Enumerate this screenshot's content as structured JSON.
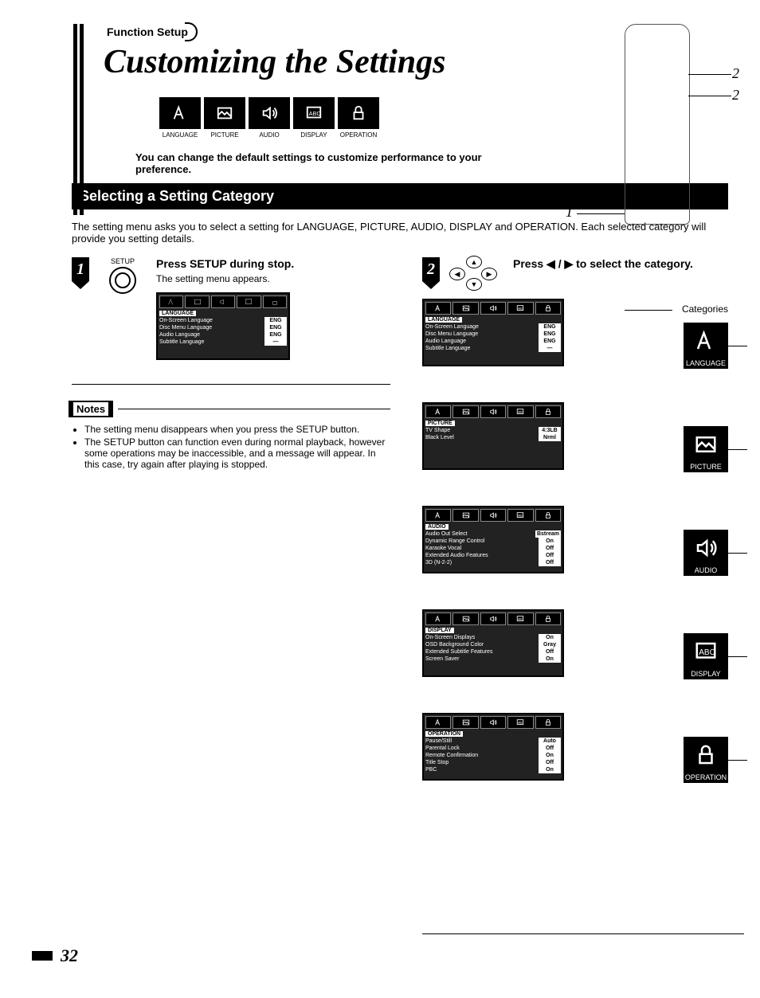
{
  "header": {
    "tag": "Function Setup",
    "title": "Customizing the Settings",
    "intro": "You can change the default settings to customize performance to your preference."
  },
  "icon_strip": [
    "LANGUAGE",
    "PICTURE",
    "AUDIO",
    "DISPLAY",
    "OPERATION"
  ],
  "remote_callouts": {
    "r1": "2",
    "r2": "2",
    "r3": "1"
  },
  "section": {
    "bar": "Selecting a Setting Category",
    "intro": "The setting menu asks you to select a setting for LANGUAGE, PICTURE, AUDIO, DISPLAY and OPERATION.  Each selected category will provide you setting details."
  },
  "step1": {
    "num": "1",
    "btn": "SETUP",
    "title": "Press SETUP during stop.",
    "sub": "The setting menu appears.",
    "osd": {
      "cat": "LANGUAGE",
      "rows": [
        {
          "k": "On-Screen Language",
          "v": "ENG"
        },
        {
          "k": "Disc Menu Language",
          "v": "ENG"
        },
        {
          "k": "Audio Language",
          "v": "ENG"
        },
        {
          "k": "Subtitle Language",
          "v": "—"
        }
      ]
    }
  },
  "notes": {
    "label": "Notes",
    "items": [
      "The setting menu disappears when you press the SETUP button.",
      "The SETUP button can function even during normal playback, however some operations may be inaccessible, and a message will appear. In this case, try again after playing is stopped."
    ]
  },
  "step2": {
    "num": "2",
    "title": "Press ◀ / ▶ to select the category.",
    "cat_label": "Categories"
  },
  "categories": [
    {
      "name": "LANGUAGE",
      "rows": [
        {
          "k": "On-Screen Language",
          "v": "ENG"
        },
        {
          "k": "Disc Menu Language",
          "v": "ENG"
        },
        {
          "k": "Audio Language",
          "v": "ENG"
        },
        {
          "k": "Subtitle Language",
          "v": "—"
        }
      ]
    },
    {
      "name": "PICTURE",
      "rows": [
        {
          "k": "TV Shape",
          "v": "4:3LB"
        },
        {
          "k": "Black Level",
          "v": "Nrml"
        }
      ]
    },
    {
      "name": "AUDIO",
      "rows": [
        {
          "k": "Audio Out Select",
          "v": "Bstream"
        },
        {
          "k": "Dynamic Range Control",
          "v": "On"
        },
        {
          "k": "Karaoke Vocal",
          "v": "Off"
        },
        {
          "k": "Extended Audio Features",
          "v": "Off"
        },
        {
          "k": "3D (N-2-2)",
          "v": "Off"
        }
      ]
    },
    {
      "name": "DISPLAY",
      "rows": [
        {
          "k": "On-Screen Displays",
          "v": "On"
        },
        {
          "k": "OSD Background Color",
          "v": "Gray"
        },
        {
          "k": "Extended Subtitle Features",
          "v": "Off"
        },
        {
          "k": "Screen Saver",
          "v": "On"
        }
      ]
    },
    {
      "name": "OPERATION",
      "rows": [
        {
          "k": "Pause/Still",
          "v": "Auto"
        },
        {
          "k": "Parental Lock",
          "v": "Off"
        },
        {
          "k": "Remote Confirmation",
          "v": "On"
        },
        {
          "k": "Title Stop",
          "v": "Off"
        },
        {
          "k": "PBC",
          "v": "On"
        }
      ]
    }
  ],
  "page_number": "32"
}
